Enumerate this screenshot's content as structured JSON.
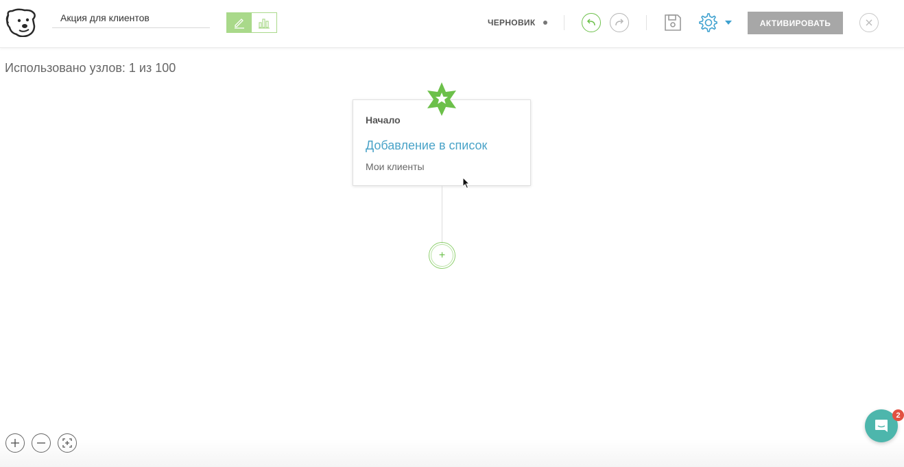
{
  "header": {
    "campaign_name": "Акция для клиентов",
    "status": "ЧЕРНОВИК",
    "activate_label": "АКТИВИРОВАТЬ",
    "icons": {
      "logo": "dog-logo-icon",
      "edit_mode": "pencil-icon",
      "stats_mode": "bar-chart-icon",
      "undo": "undo-icon",
      "redo": "redo-icon",
      "save": "floppy-disk-icon",
      "settings": "gear-icon",
      "close": "close-icon"
    },
    "colors": {
      "accent_green": "#6cc04a",
      "accent_blue": "#3ea1cf",
      "activate_bg": "#a7a7a7"
    }
  },
  "canvas": {
    "usage_text": "Использовано узлов: 1 из 100",
    "start_node": {
      "title": "Начало",
      "action": "Добавление в список",
      "list_name": "Мои клиенты",
      "icon": "star-icon"
    },
    "add_node_symbol": "+"
  },
  "zoom_controls": {
    "zoom_in_symbol": "+",
    "zoom_out_symbol": "−"
  },
  "chat": {
    "badge_count": "2",
    "icon": "chat-icon",
    "color": "#4db6ac"
  }
}
